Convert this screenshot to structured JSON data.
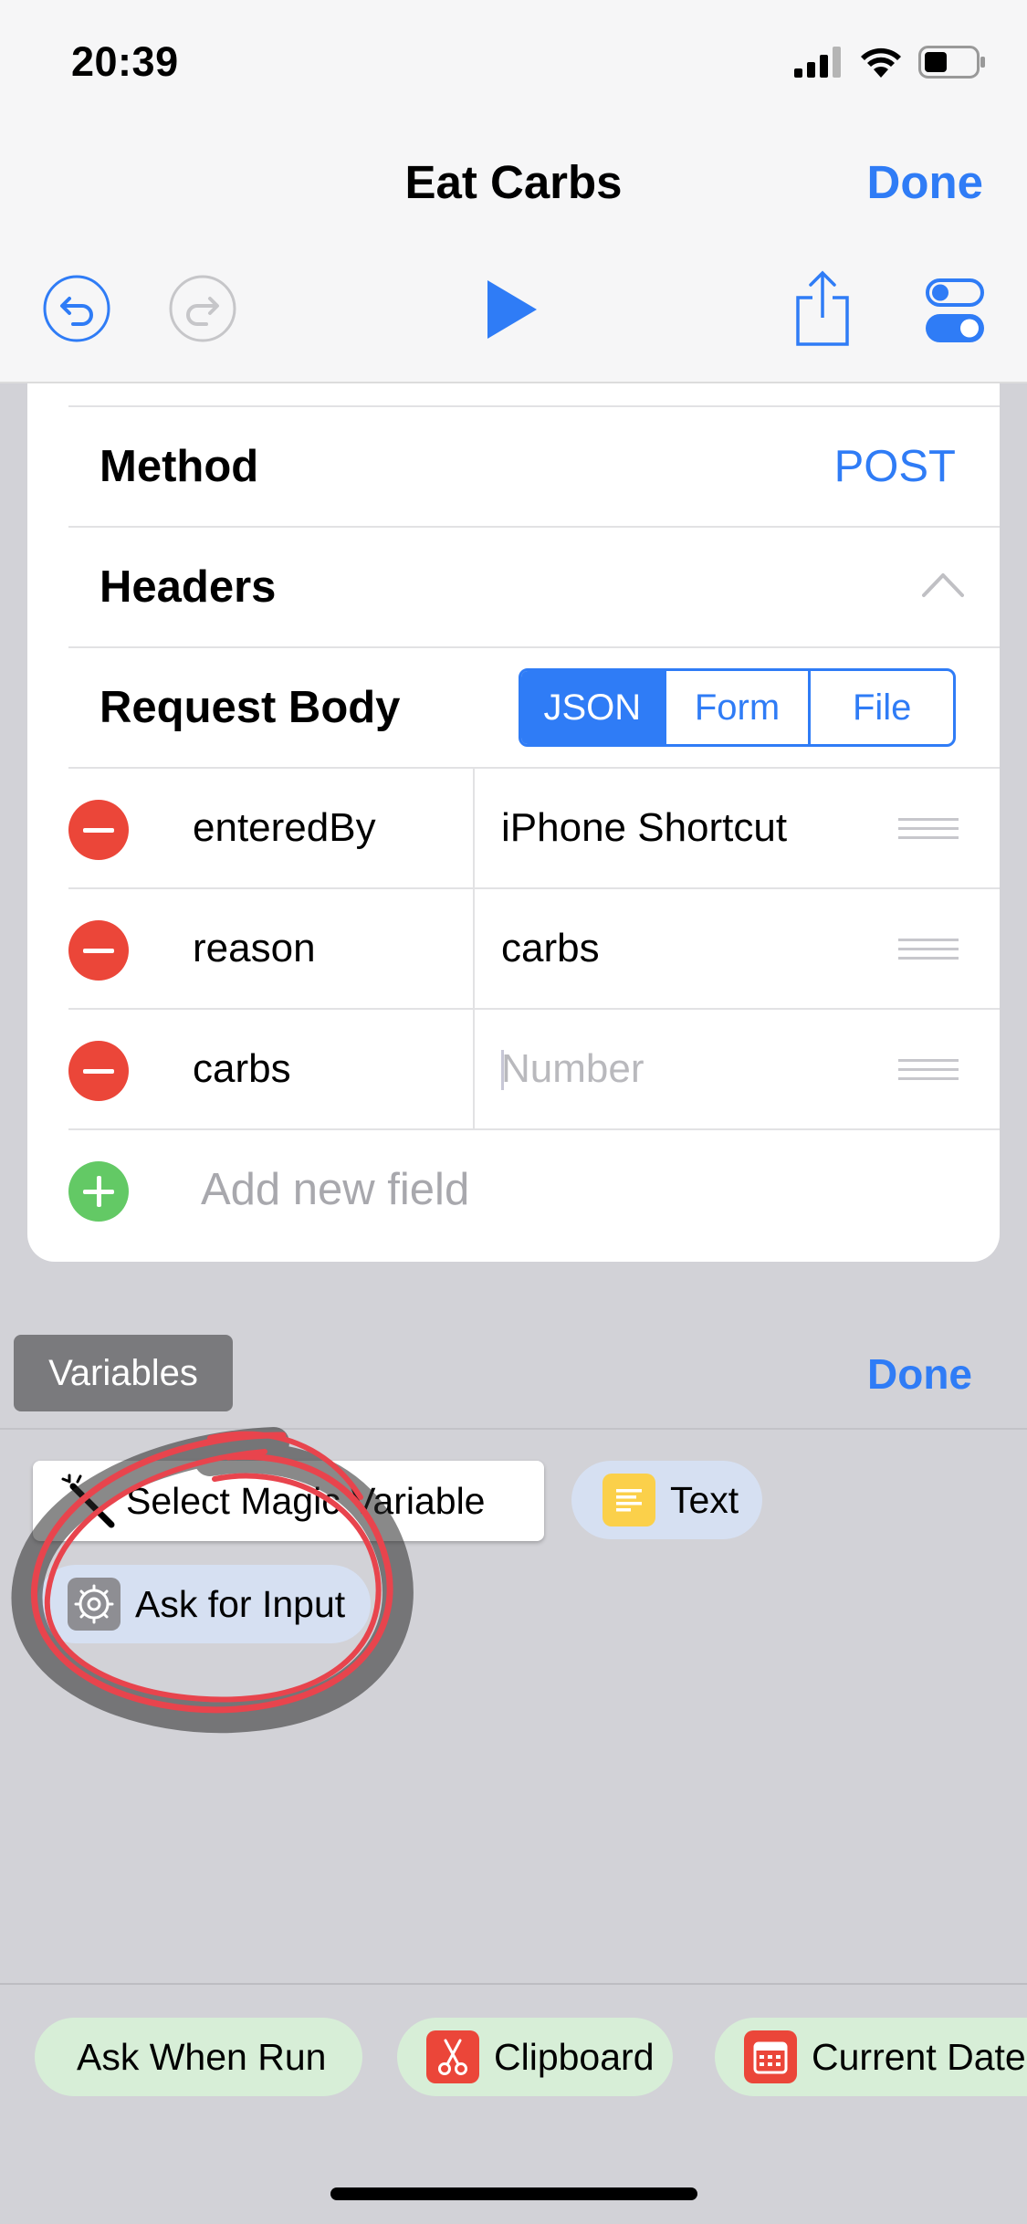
{
  "status": {
    "time": "20:39"
  },
  "nav": {
    "title": "Eat Carbs",
    "done_label": "Done"
  },
  "toolbar": {
    "undo_icon": "undo-icon",
    "redo_icon": "redo-icon",
    "play_icon": "play-icon",
    "share_icon": "share-icon",
    "settings_icon": "toggle-settings-icon"
  },
  "request": {
    "method_label": "Method",
    "method_value": "POST",
    "headers_label": "Headers",
    "body_label": "Request Body",
    "body_types": [
      "JSON",
      "Form",
      "File"
    ],
    "body_type_selected": "JSON",
    "fields": [
      {
        "key": "enteredBy",
        "value": "iPhone Shortcut",
        "placeholder": ""
      },
      {
        "key": "reason",
        "value": "carbs",
        "placeholder": ""
      },
      {
        "key": "carbs",
        "value": "",
        "placeholder": "Number"
      }
    ],
    "add_field_label": "Add new field"
  },
  "variables": {
    "tab_label": "Variables",
    "done_label": "Done",
    "chips": [
      {
        "label": "Select Magic Variable",
        "icon": "magic-wand-icon"
      },
      {
        "label": "Text",
        "icon": "text-icon"
      },
      {
        "label": "Ask for Input",
        "icon": "gear-icon"
      }
    ],
    "bottom_chips": [
      {
        "label": "Ask When Run",
        "icon": ""
      },
      {
        "label": "Clipboard",
        "icon": "scissors-icon"
      },
      {
        "label": "Current Date",
        "icon": "calendar-icon"
      }
    ]
  },
  "colors": {
    "accent": "#2f7cf6",
    "destructive": "#eb4639",
    "add": "#63c965",
    "annotation": "#e8444d"
  }
}
